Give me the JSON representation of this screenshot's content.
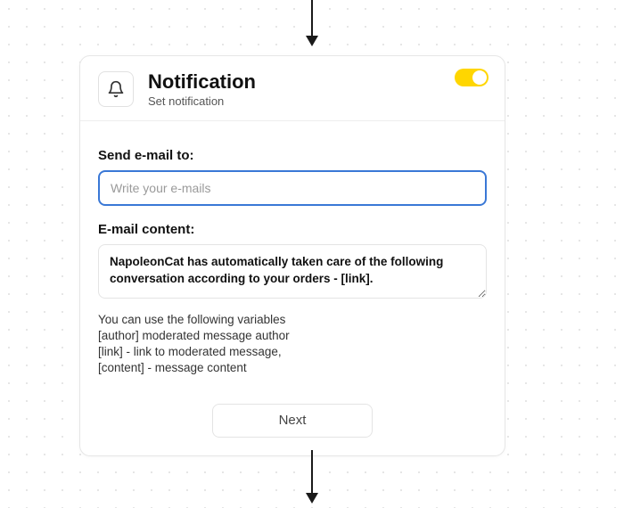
{
  "header": {
    "title": "Notification",
    "subtitle": "Set notification",
    "toggle_on": true
  },
  "form": {
    "email_label": "Send e-mail to:",
    "email_placeholder": "Write your e-mails",
    "content_label": "E-mail content:",
    "content_value": "NapoleonCat has automatically taken care of the following conversation according to your orders - [link].",
    "hint": "You can use the following variables\n[author] moderated message author\n[link] - link to moderated message,\n[content] - message content",
    "next_label": "Next"
  },
  "icons": {
    "header_icon": "bell-icon"
  },
  "colors": {
    "accent_toggle": "#ffd600",
    "input_focus_border": "#3a78d6"
  }
}
